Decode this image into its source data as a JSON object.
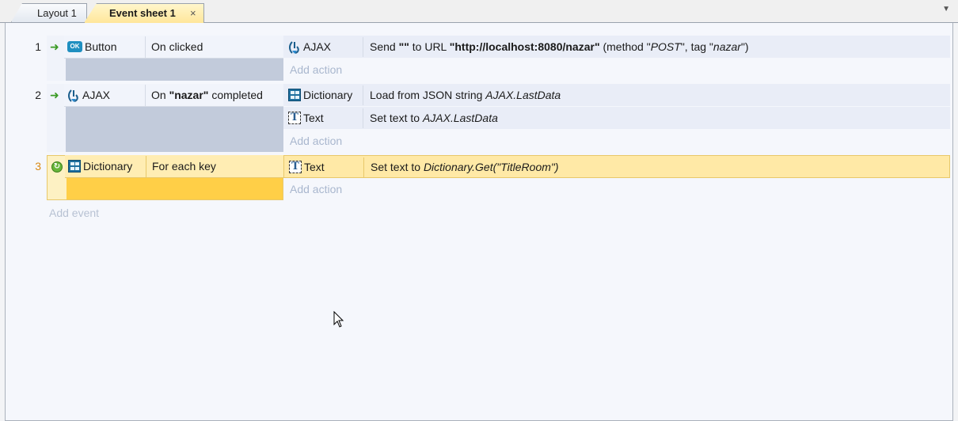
{
  "tabs": [
    {
      "label": "Layout 1",
      "active": false
    },
    {
      "label": "Event sheet 1",
      "active": true,
      "close": "×"
    }
  ],
  "tab_dropdown": "▼",
  "events": [
    {
      "number": "1",
      "condition": {
        "object": "Button",
        "icon": "button-ok-icon",
        "text": "On clicked"
      },
      "actions": [
        {
          "object": "AJAX",
          "icon": "ajax-icon",
          "parts": {
            "p1": "Send ",
            "p2": "\"\"",
            "p3": " to URL ",
            "p4": "\"http://localhost:8080/nazar\"",
            "p5": " (method \"",
            "p6": "POST",
            "p7": "\", tag \"",
            "p8": "nazar",
            "p9": "\")"
          }
        }
      ]
    },
    {
      "number": "2",
      "condition": {
        "object": "AJAX",
        "icon": "ajax-icon",
        "text_pre": "On ",
        "text_bold": "\"nazar\"",
        "text_post": " completed"
      },
      "actions": [
        {
          "object": "Dictionary",
          "icon": "dictionary-icon",
          "text_pre": "Load from JSON string ",
          "text_italic": "AJAX.LastData"
        },
        {
          "object": "Text",
          "icon": "text-icon",
          "text_pre": "Set text to ",
          "text_italic": "AJAX.LastData"
        }
      ]
    },
    {
      "number": "3",
      "selected": true,
      "condition": {
        "object": "Dictionary",
        "icon": "dictionary-icon",
        "text": "For each key"
      },
      "actions": [
        {
          "object": "Text",
          "icon": "text-icon",
          "text_pre": "Set text to ",
          "text_italic": "Dictionary.Get(\"TitleRoom\")"
        }
      ]
    }
  ],
  "add_action_label": "Add action",
  "add_event_label": "Add event",
  "colors": {
    "selected": "#ffcf47",
    "event_block": "#c2cbdb",
    "add_text": "#a9b7ce"
  }
}
